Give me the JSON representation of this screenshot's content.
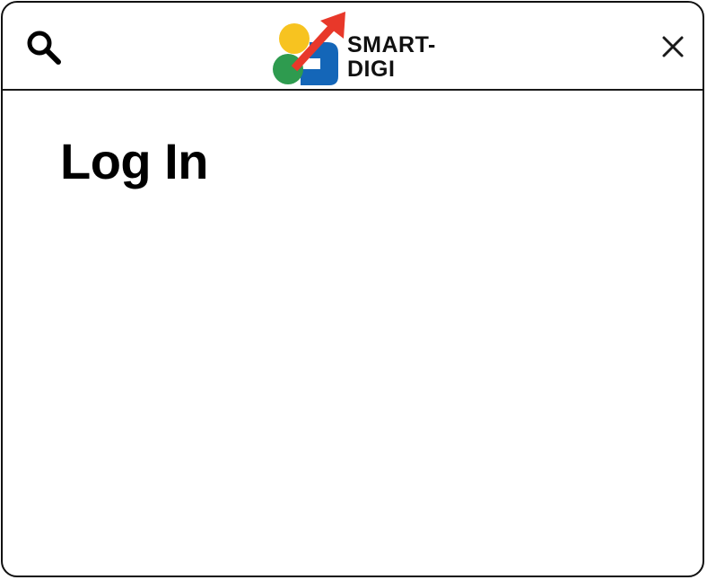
{
  "header": {
    "logo": {
      "line1": "SMART-",
      "line2": "DIGI",
      "colors": {
        "yellow": "#F7C320",
        "green": "#2E9B4F",
        "blue": "#1466B8",
        "red": "#E8382A"
      }
    },
    "icons": {
      "search": "search-icon",
      "close": "close-icon"
    }
  },
  "main": {
    "title": "Log In"
  }
}
